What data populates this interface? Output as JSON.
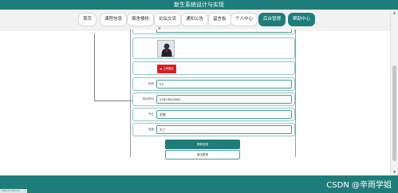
{
  "header": {
    "site_title": "新生系统设计与实现"
  },
  "nav": {
    "items": [
      {
        "label": "首页",
        "accent": false
      },
      {
        "label": "课程信息",
        "accent": false
      },
      {
        "label": "宿舍楼栋",
        "accent": false
      },
      {
        "label": "论坛交流",
        "accent": false
      },
      {
        "label": "通知公告",
        "accent": false
      },
      {
        "label": "留言板",
        "accent": false
      },
      {
        "label": "个人中心",
        "accent": false
      },
      {
        "label": "后台管理",
        "accent": true
      },
      {
        "label": "帮助中心",
        "accent": true
      }
    ]
  },
  "form": {
    "top_value": "号",
    "upload_label": "上传图片",
    "rows": [
      {
        "label": "年龄",
        "value": "23"
      },
      {
        "label": "电话号码",
        "value": "13813813800"
      },
      {
        "label": "专业",
        "value": "金融"
      },
      {
        "label": "班级",
        "value": "大三"
      }
    ]
  },
  "actions": {
    "update_label": "更新信息",
    "logout_label": "退出登录"
  },
  "footer": {
    "watermark": "CSDN @辛雨学姐",
    "corner_text": "http://localhost"
  },
  "colors": {
    "primary": "#1e7d7a",
    "accent_red": "#d81f26"
  }
}
